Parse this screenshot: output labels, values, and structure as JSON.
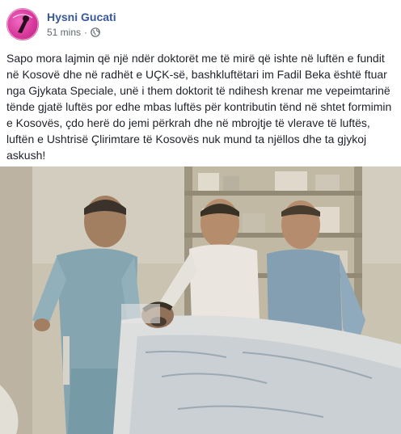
{
  "post": {
    "author_name": "Hysni Gucati",
    "timestamp": "51 mins",
    "separator": "·",
    "privacy_icon": "globe-icon",
    "avatar_icon": "profile-avatar",
    "body_text": "Sapo mora lajmin që një ndër doktorët me të mirë që ishte në luftën e fundit në Kosovë dhe në radhët e UÇK-së, bashkluftëtari im Fadil Beka është ftuar nga Gjykata Speciale, unë i them doktorit të ndihesh krenar me vepeimtarinë tënde gjatë luftës por edhe mbas luftës për kontributin tënd në shtet formimin e Kosovës, çdo herë do jemi përkrah dhe në mbrojtje të vlerave të luftës, luftën e Ushtrisë Çlirimtare të Kosovës nuk mund ta njëllos dhe ta gjykoj askush!",
    "link_color": "#385898",
    "meta_color": "#606770"
  }
}
